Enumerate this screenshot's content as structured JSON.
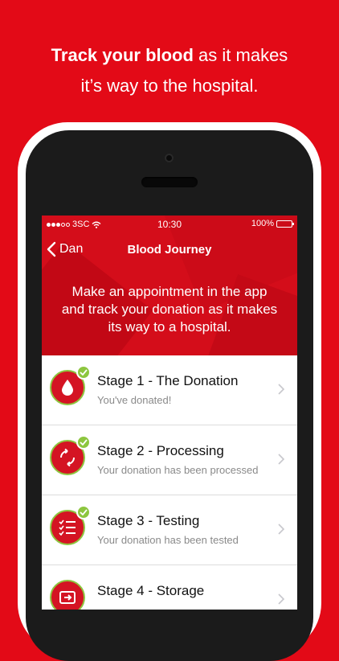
{
  "headline": {
    "bold": "Track your blood",
    "rest1": " as it makes",
    "line2": "it’s way to the hospital."
  },
  "status_bar": {
    "carrier": "3SC",
    "time": "10:30",
    "battery": "100%"
  },
  "nav": {
    "back_label": "Dan",
    "title": "Blood Journey"
  },
  "hero": {
    "line1": "Make an appointment in the app",
    "line2": "and track your donation as it makes",
    "line3": "its way to a hospital."
  },
  "stages": [
    {
      "title": "Stage 1 - The Donation",
      "subtitle": "You've donated!",
      "icon": "blood-drop-icon"
    },
    {
      "title": "Stage 2 - Processing",
      "subtitle": "Your donation has been processed",
      "icon": "processing-arrows-icon"
    },
    {
      "title": "Stage 3 - Testing",
      "subtitle": "Your donation has been tested",
      "icon": "checklist-icon"
    },
    {
      "title": "Stage 4 - Storage",
      "subtitle": "",
      "icon": "storage-icon"
    }
  ],
  "colors": {
    "brand_red": "#e30a17",
    "hero_red": "#d40d1a",
    "complete_green": "#8dc63f"
  }
}
